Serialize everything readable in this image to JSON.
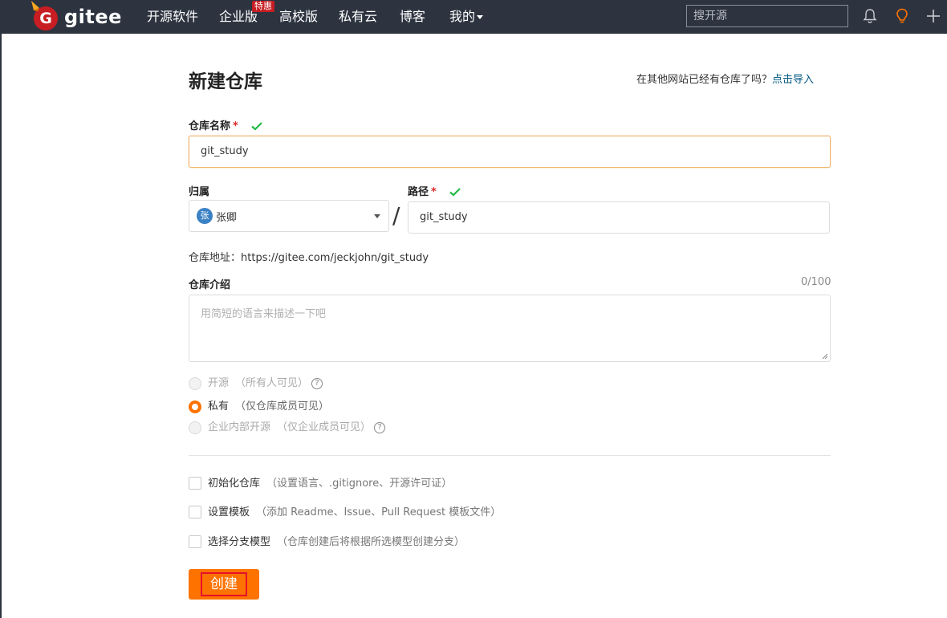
{
  "navbar": {
    "logo_letter": "G",
    "logo_text": "gitee",
    "items": [
      {
        "label": "开源软件"
      },
      {
        "label": "企业版"
      },
      {
        "label": "高校版"
      },
      {
        "label": "私有云"
      },
      {
        "label": "博客"
      },
      {
        "label": "我的"
      }
    ],
    "enterprise_badge": "特惠",
    "search_placeholder": "搜开源",
    "icons": [
      "bell-icon",
      "lightbulb-icon",
      "plus-icon"
    ]
  },
  "page": {
    "title": "新建仓库",
    "import_question": "在其他网站已经有仓库了吗？",
    "import_link": "点击导入"
  },
  "form": {
    "name_label": "仓库名称",
    "required_mark": "*",
    "name_value": "git_study",
    "owner_label": "归属",
    "owner_avatar": "张",
    "owner_name": "张卿",
    "path_label": "路径",
    "path_value": "git_study",
    "path_separator": "/",
    "address_label": "仓库地址：",
    "address_value": "https://gitee.com/jeckjohn/git_study",
    "intro_label": "仓库介绍",
    "intro_counter": "0/100",
    "intro_placeholder": "用简短的语言来描述一下吧",
    "visibility": [
      {
        "label": "开源",
        "sub": "（所有人可见）",
        "selected": false,
        "disabled": true,
        "help": "?"
      },
      {
        "label": "私有",
        "sub": "（仅仓库成员可见）",
        "selected": true,
        "disabled": false,
        "help": ""
      },
      {
        "label": "企业内部开源",
        "sub": "（仅企业成员可见）",
        "selected": false,
        "disabled": true,
        "help": "?"
      }
    ],
    "options": [
      {
        "label": "初始化仓库",
        "sub": "（设置语言、.gitignore、开源许可证）",
        "checked": false
      },
      {
        "label": "设置模板",
        "sub": "（添加 Readme、Issue、Pull Request 模板文件）",
        "checked": false
      },
      {
        "label": "选择分支模型",
        "sub": "（仓库创建后将根据所选模型创建分支）",
        "checked": false
      }
    ],
    "submit_label": "创建"
  },
  "colors": {
    "navbar_bg": "#2d3440",
    "accent_orange": "#fe7300",
    "brand_red": "#c71d23",
    "link_blue": "#005980",
    "check_green": "#21ba45"
  }
}
